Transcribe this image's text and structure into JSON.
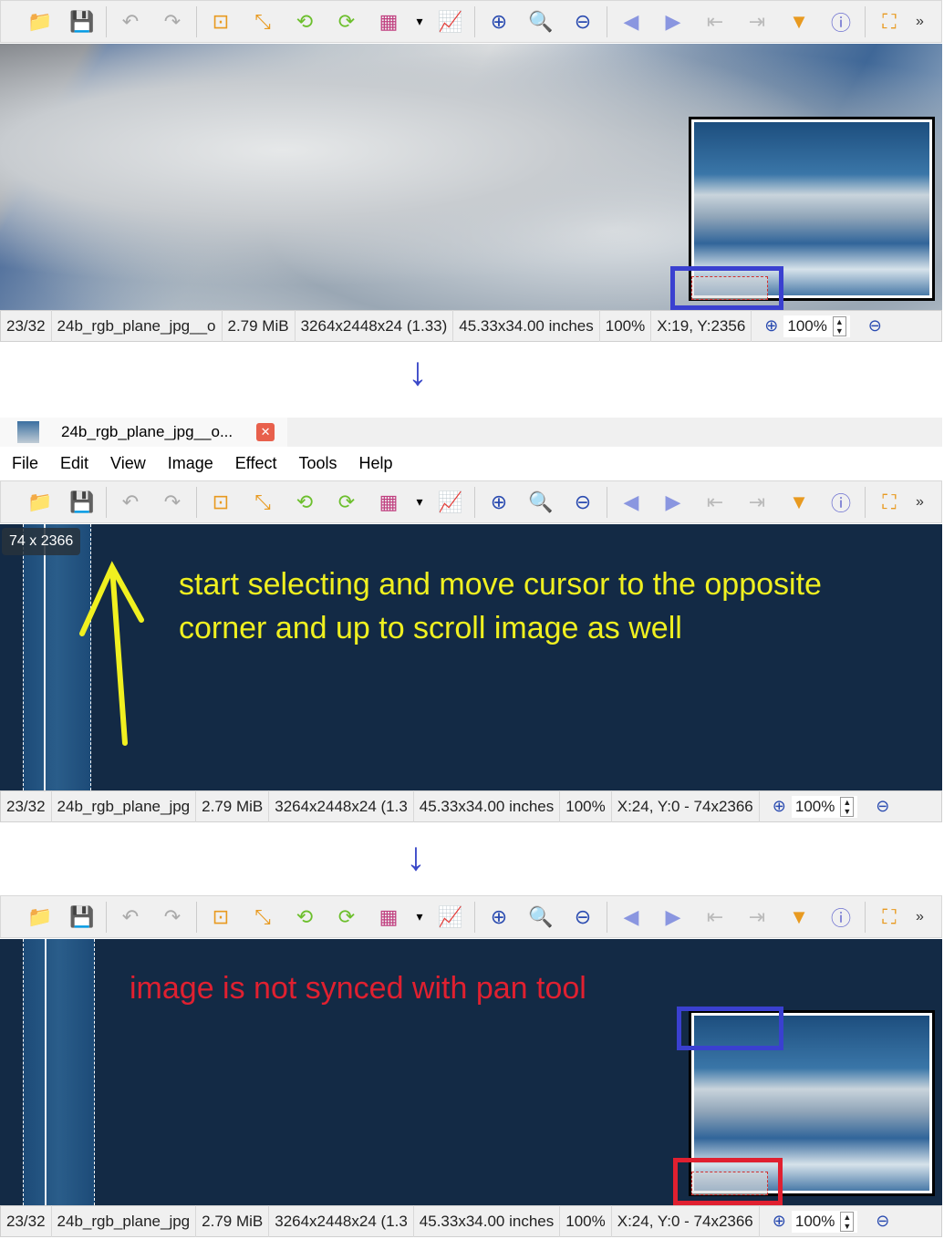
{
  "toolbar": [
    {
      "name": "open-folder",
      "glyph": "📁",
      "color": "#e8b040"
    },
    {
      "name": "save",
      "glyph": "💾",
      "color": "#6b6fd0"
    },
    {
      "sep": true
    },
    {
      "name": "undo",
      "glyph": "↶",
      "color": "#aaa"
    },
    {
      "name": "redo",
      "glyph": "↷",
      "color": "#aaa"
    },
    {
      "sep": true
    },
    {
      "name": "crop",
      "glyph": "⊡",
      "color": "#e89a20"
    },
    {
      "name": "resize",
      "glyph": "⤡",
      "color": "#e89a20"
    },
    {
      "name": "rotate-left",
      "glyph": "⟲",
      "color": "#6cbf2c"
    },
    {
      "name": "rotate-right",
      "glyph": "⟳",
      "color": "#6cbf2c"
    },
    {
      "name": "color-adjust",
      "glyph": "▦",
      "color": "#c04080"
    },
    {
      "name": "dropdown",
      "glyph": "▾",
      "color": "#000"
    },
    {
      "name": "histogram",
      "glyph": "📈",
      "color": "#444"
    },
    {
      "sep": true
    },
    {
      "name": "zoom-in",
      "glyph": "⊕",
      "color": "#2a4bb0"
    },
    {
      "name": "zoom-1to1",
      "glyph": "🔍",
      "color": "#2a4bb0"
    },
    {
      "name": "zoom-out",
      "glyph": "⊖",
      "color": "#2a4bb0"
    },
    {
      "sep": true
    },
    {
      "name": "previous",
      "glyph": "◀",
      "color": "#8a96e0"
    },
    {
      "name": "next",
      "glyph": "▶",
      "color": "#8a96e0"
    },
    {
      "name": "first",
      "glyph": "⇤",
      "color": "#bbb"
    },
    {
      "name": "last",
      "glyph": "⇥",
      "color": "#bbb"
    },
    {
      "name": "slideshow",
      "glyph": "▼",
      "color": "#e89a20"
    },
    {
      "name": "info",
      "glyph": "ⓘ",
      "color": "#6b6fd0"
    },
    {
      "sep": true
    },
    {
      "name": "fullscreen",
      "glyph": "⛶",
      "color": "#e89a20"
    }
  ],
  "toolbar_more": "»",
  "tab": {
    "title": "24b_rgb_plane_jpg__o...",
    "close": "✕"
  },
  "menu": [
    "File",
    "Edit",
    "View",
    "Image",
    "Effect",
    "Tools",
    "Help"
  ],
  "status1": {
    "index": "23/32",
    "file": "24b_rgb_plane_jpg__o",
    "size": "2.79 MiB",
    "dims": "3264x2448x24 (1.33)",
    "print": "45.33x34.00 inches",
    "zoom": "100%",
    "coords": "X:19, Y:2356",
    "zoom_value": "100%"
  },
  "status2": {
    "index": "23/32",
    "file": "24b_rgb_plane_jpg",
    "size": "2.79 MiB",
    "dims": "3264x2448x24 (1.3",
    "print": "45.33x34.00 inches",
    "zoom": "100%",
    "coords": "X:24, Y:0 - 74x2366",
    "zoom_value": "100%"
  },
  "status3": {
    "index": "23/32",
    "file": "24b_rgb_plane_jpg",
    "size": "2.79 MiB",
    "dims": "3264x2448x24 (1.3",
    "print": "45.33x34.00 inches",
    "zoom": "100%",
    "coords": "X:24, Y:0 - 74x2366",
    "zoom_value": "100%"
  },
  "selection_tooltip": "74 x 2366",
  "annotations": {
    "note1": "start selecting and move cursor to the opposite corner and up to scroll image as well",
    "note2": "image is not synced with pan tool",
    "arrow": "↓",
    "colors": {
      "yellow": "#f0f020",
      "red": "#e02030",
      "blue": "#3a40d0"
    }
  }
}
